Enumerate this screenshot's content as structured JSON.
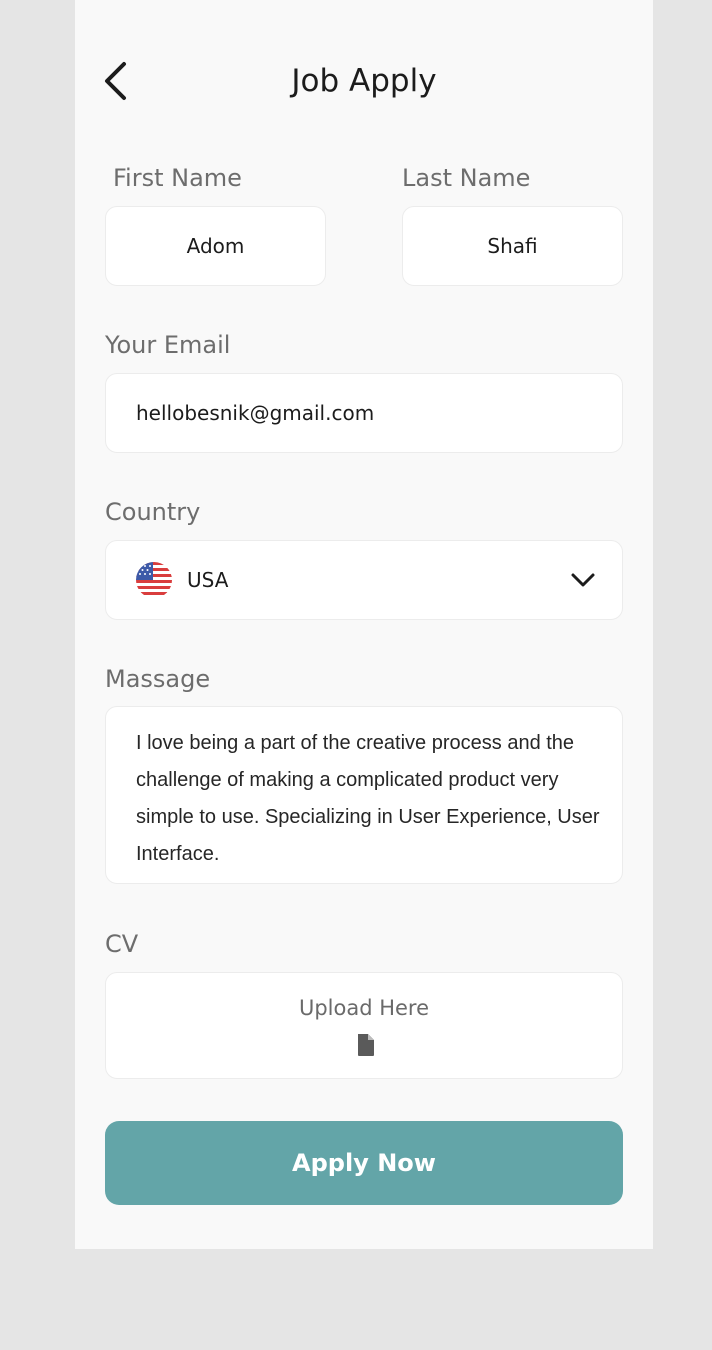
{
  "header": {
    "title": "Job Apply",
    "back_icon": "chevron-left-icon"
  },
  "form": {
    "first_name": {
      "label": "First Name",
      "value": "Adom"
    },
    "last_name": {
      "label": "Last Name",
      "value": "Shafi"
    },
    "email": {
      "label": "Your Email",
      "value": "hellobesnik@gmail.com"
    },
    "country": {
      "label": "Country",
      "value": "USA",
      "flag_icon": "us-flag-icon",
      "dropdown_icon": "chevron-down-icon"
    },
    "message": {
      "label": "Massage",
      "value": "I love being a part of the creative process and the challenge of making a complicated product very simple to use. Specializing in User Experience, User Interface."
    },
    "cv": {
      "label": "CV",
      "upload_text": "Upload Here",
      "upload_icon": "file-icon"
    },
    "submit_label": "Apply Now"
  },
  "colors": {
    "accent": "#63a5a8",
    "background": "#e5e5e5",
    "card": "#f9f9f9"
  }
}
